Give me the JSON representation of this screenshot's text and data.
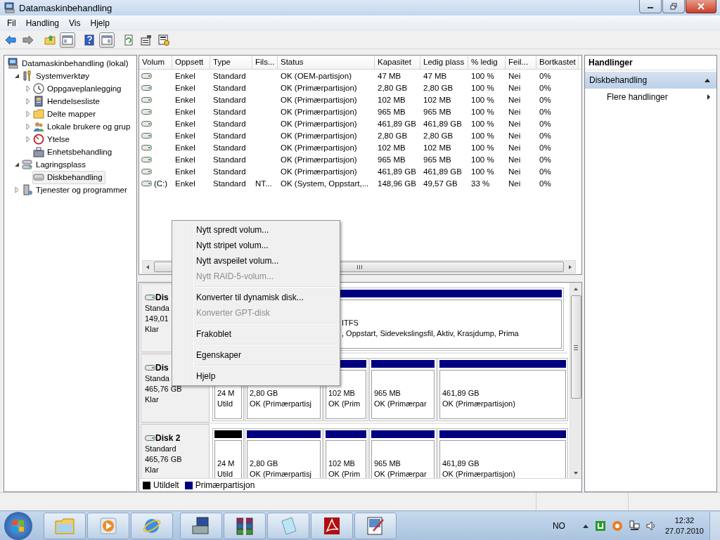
{
  "window": {
    "title": "Datamaskinbehandling"
  },
  "menu": [
    "Fil",
    "Handling",
    "Vis",
    "Hjelp"
  ],
  "tree": [
    {
      "label": "Datamaskinbehandling (lokal)",
      "selected": false,
      "children": [
        {
          "label": "Systemverktøy",
          "kind": "node",
          "expanded": true,
          "selected": false,
          "children": [
            {
              "label": "Oppgaveplanlegging",
              "kind": "node",
              "expanded": false,
              "selected": false
            },
            {
              "label": "Hendelsesliste",
              "kind": "node",
              "expanded": false,
              "selected": false
            },
            {
              "label": "Delte mapper",
              "kind": "node",
              "expanded": false,
              "selected": false
            },
            {
              "label": "Lokale brukere og grup",
              "kind": "node",
              "expanded": false,
              "selected": false
            },
            {
              "label": "Ytelse",
              "kind": "node",
              "expanded": false,
              "selected": false
            },
            {
              "label": "Enhetsbehandling",
              "kind": "plain",
              "selected": false
            }
          ]
        },
        {
          "label": "Lagringsplass",
          "kind": "node",
          "expanded": true,
          "selected": false,
          "children": [
            {
              "label": "Diskbehandling",
              "kind": "plain",
              "selected": true
            }
          ]
        },
        {
          "label": "Tjenester og programmer",
          "kind": "node",
          "expanded": false,
          "selected": false
        }
      ]
    }
  ],
  "table": {
    "columns": [
      "Volum",
      "Oppsett",
      "Type",
      "Fils...",
      "Status",
      "Kapasitet",
      "Ledig plass",
      "% ledig",
      "Feil...",
      "Bortkastet"
    ],
    "rows": [
      {
        "cells": [
          "",
          "Enkel",
          "Standard",
          "",
          "OK (OEM-partisjon)",
          "47 MB",
          "47 MB",
          "100 %",
          "Nei",
          "0%"
        ]
      },
      {
        "cells": [
          "",
          "Enkel",
          "Standard",
          "",
          "OK (Primærpartisjon)",
          "2,80 GB",
          "2,80 GB",
          "100 %",
          "Nei",
          "0%"
        ]
      },
      {
        "cells": [
          "",
          "Enkel",
          "Standard",
          "",
          "OK (Primærpartisjon)",
          "102 MB",
          "102 MB",
          "100 %",
          "Nei",
          "0%"
        ]
      },
      {
        "cells": [
          "",
          "Enkel",
          "Standard",
          "",
          "OK (Primærpartisjon)",
          "965 MB",
          "965 MB",
          "100 %",
          "Nei",
          "0%"
        ]
      },
      {
        "cells": [
          "",
          "Enkel",
          "Standard",
          "",
          "OK (Primærpartisjon)",
          "461,89 GB",
          "461,89 GB",
          "100 %",
          "Nei",
          "0%"
        ]
      },
      {
        "cells": [
          "",
          "Enkel",
          "Standard",
          "",
          "OK (Primærpartisjon)",
          "2,80 GB",
          "2,80 GB",
          "100 %",
          "Nei",
          "0%"
        ]
      },
      {
        "cells": [
          "",
          "Enkel",
          "Standard",
          "",
          "OK (Primærpartisjon)",
          "102 MB",
          "102 MB",
          "100 %",
          "Nei",
          "0%"
        ]
      },
      {
        "cells": [
          "",
          "Enkel",
          "Standard",
          "",
          "OK (Primærpartisjon)",
          "965 MB",
          "965 MB",
          "100 %",
          "Nei",
          "0%"
        ]
      },
      {
        "cells": [
          "",
          "Enkel",
          "Standard",
          "",
          "OK (Primærpartisjon)",
          "461,89 GB",
          "461,89 GB",
          "100 %",
          "Nei",
          "0%"
        ]
      },
      {
        "cells": [
          "(C:)",
          "Enkel",
          "Standard",
          "NT...",
          "OK (System, Oppstart,...",
          "148,96 GB",
          "49,57 GB",
          "33 %",
          "Nei",
          "0%"
        ]
      }
    ]
  },
  "disks": [
    {
      "name": "Dis",
      "type": "Standa",
      "size": "149,01",
      "status": "Klar",
      "partitions": [
        {
          "kind": "primary",
          "lines": [
            "ITFS",
            ", Oppstart, Sidevekslingsfil, Aktiv, Krasjdump, Prima"
          ]
        }
      ]
    },
    {
      "name": "Dis",
      "type": "Standa",
      "size": "465,76 GB",
      "status": "Klar",
      "partitions": [
        {
          "kind": "unallocated",
          "lines": [
            "24 M",
            "Utild"
          ]
        },
        {
          "kind": "primary",
          "lines": [
            "2,80 GB",
            "OK (Primærpartisj"
          ]
        },
        {
          "kind": "primary",
          "lines": [
            "102 MB",
            "OK (Prim"
          ]
        },
        {
          "kind": "primary",
          "lines": [
            "965 MB",
            "OK (Primærpar"
          ]
        },
        {
          "kind": "primary",
          "lines": [
            "461,89 GB",
            "OK (Primærpartisjon)"
          ]
        }
      ]
    },
    {
      "name": "Disk 2",
      "type": "Standard",
      "size": "465,76 GB",
      "status": "Klar",
      "partitions": [
        {
          "kind": "unallocated",
          "lines": [
            "24 M",
            "Utild"
          ]
        },
        {
          "kind": "primary",
          "lines": [
            "2,80 GB",
            "OK (Primærpartisj"
          ]
        },
        {
          "kind": "primary",
          "lines": [
            "102 MB",
            "OK (Prim"
          ]
        },
        {
          "kind": "primary",
          "lines": [
            "965 MB",
            "OK (Primærpar"
          ]
        },
        {
          "kind": "primary",
          "lines": [
            "461,89 GB",
            "OK (Primærpartisjon)"
          ]
        }
      ]
    }
  ],
  "legend": [
    {
      "label": "Utildelt",
      "color": "#000000"
    },
    {
      "label": "Primærpartisjon",
      "color": "#000080"
    }
  ],
  "context_menu": {
    "groups": [
      [
        {
          "label": "Nytt spredt volum...",
          "disabled": false
        },
        {
          "label": "Nytt stripet volum...",
          "disabled": false
        },
        {
          "label": "Nytt avspeilet volum...",
          "disabled": false
        },
        {
          "label": "Nytt RAID-5-volum...",
          "disabled": true
        }
      ],
      [
        {
          "label": "Konverter til dynamisk disk...",
          "disabled": false
        },
        {
          "label": "Konverter GPT-disk",
          "disabled": true
        }
      ],
      [
        {
          "label": "Frakoblet",
          "disabled": false
        }
      ],
      [
        {
          "label": "Egenskaper",
          "disabled": false
        }
      ],
      [
        {
          "label": "Hjelp",
          "disabled": false
        }
      ]
    ]
  },
  "actions": {
    "title": "Handlinger",
    "sections": [
      {
        "label": "Diskbehandling",
        "expanded": true,
        "items": [
          {
            "label": "Flere handlinger"
          }
        ]
      }
    ]
  },
  "taskbar": {
    "language": "NO",
    "time": "12:32",
    "date": "27.07.2010"
  }
}
